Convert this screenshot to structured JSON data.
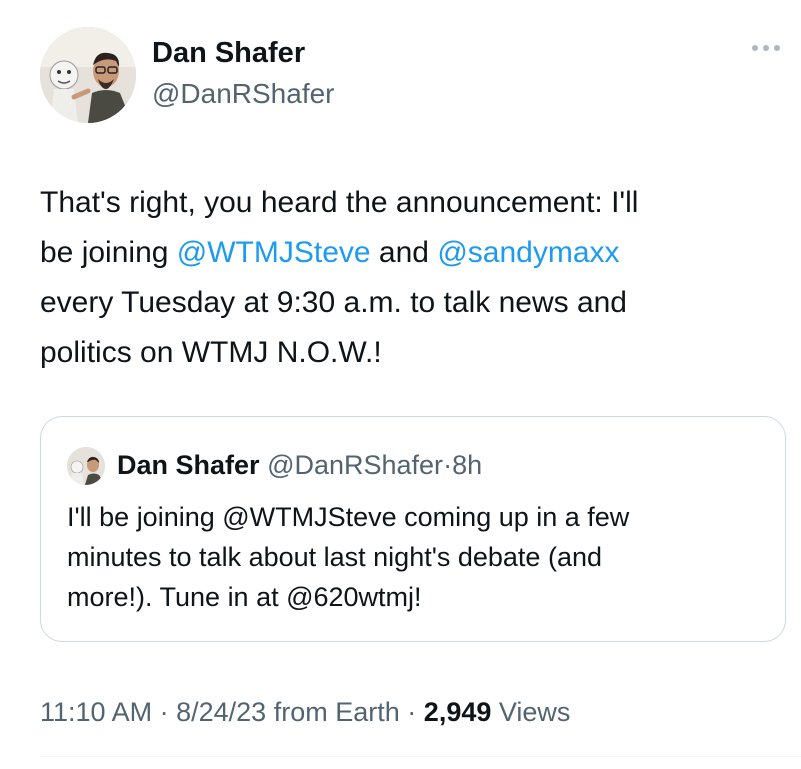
{
  "author": {
    "name": "Dan Shafer",
    "handle": "@DanRShafer",
    "more_icon": "more-horizontal-icon"
  },
  "tweet": {
    "line1": "That's right, you heard the announcement: I'll",
    "line2_pre": "be joining ",
    "mention1": "@WTMJSteve",
    "line2_mid": " and ",
    "mention2": "@sandymaxx",
    "line3": "every Tuesday at 9:30 a.m. to talk news and",
    "line4": "politics on WTMJ N.O.W.!"
  },
  "quote": {
    "name": "Dan Shafer",
    "handle": "@DanRShafer",
    "separator": "·",
    "time": "8h",
    "line1": "I'll be joining @WTMJSteve coming up in a few",
    "line2": "minutes to talk about last night's debate (and",
    "line3": "more!). Tune in at @620wtmj!"
  },
  "meta": {
    "time": "11:10 AM",
    "separator": "·",
    "date": "8/24/23",
    "source": "from Earth",
    "views_count": "2,949",
    "views_label": "Views"
  },
  "colors": {
    "text": "#0f1419",
    "secondary": "#536471",
    "link": "#1d9bf0",
    "border": "#cfd9de"
  }
}
